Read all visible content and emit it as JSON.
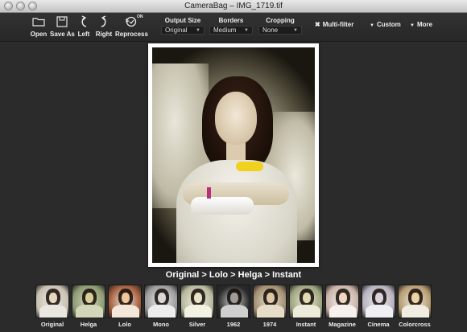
{
  "window": {
    "title": "CameraBag – IMG_1719.tif"
  },
  "toolbar": {
    "open_label": "Open",
    "save_as_label": "Save As",
    "left_label": "Left",
    "right_label": "Right",
    "reprocess_label": "Reprocess",
    "reprocess_badge": "ON",
    "output_size": {
      "label": "Output Size",
      "value": "Original"
    },
    "borders": {
      "label": "Borders",
      "value": "Medium"
    },
    "cropping": {
      "label": "Cropping",
      "value": "None"
    },
    "multifilter_label": "Multi-filter",
    "custom_label": "Custom",
    "more_label": "More"
  },
  "breadcrumb": "Original > Lolo > Helga > Instant",
  "filters": [
    {
      "label": "Original",
      "tint": "#c9c1b2",
      "face": "#e6d6bf",
      "dress": "#e9e7e0"
    },
    {
      "label": "Helga",
      "tint": "#8b9a72",
      "face": "#d7cf9b",
      "dress": "#d3d6b9"
    },
    {
      "label": "Lolo",
      "tint": "#a05a3a",
      "face": "#f0c69a",
      "dress": "#f3e7d9"
    },
    {
      "label": "Mono",
      "tint": "#9a9a9a",
      "face": "#d8d8d8",
      "dress": "#ededed"
    },
    {
      "label": "Silver",
      "tint": "#b7b79c",
      "face": "#e6e4c6",
      "dress": "#f2f1e2"
    },
    {
      "label": "1962",
      "tint": "#2a2a2a",
      "face": "#9c9c9c",
      "dress": "#cfcfcf"
    },
    {
      "label": "1974",
      "tint": "#a28f72",
      "face": "#dcc8a4",
      "dress": "#e6dcc8"
    },
    {
      "label": "Instant",
      "tint": "#9ca27c",
      "face": "#e2dcb0",
      "dress": "#ecebd9"
    },
    {
      "label": "Magazine",
      "tint": "#c9b3a8",
      "face": "#f2d6c4",
      "dress": "#f6f1ee"
    },
    {
      "label": "Cinema",
      "tint": "#b6b0bc",
      "face": "#dcd2dc",
      "dress": "#efeef3"
    },
    {
      "label": "Colorcross",
      "tint": "#b59a70",
      "face": "#ecd2a4",
      "dress": "#f0ece1"
    }
  ]
}
